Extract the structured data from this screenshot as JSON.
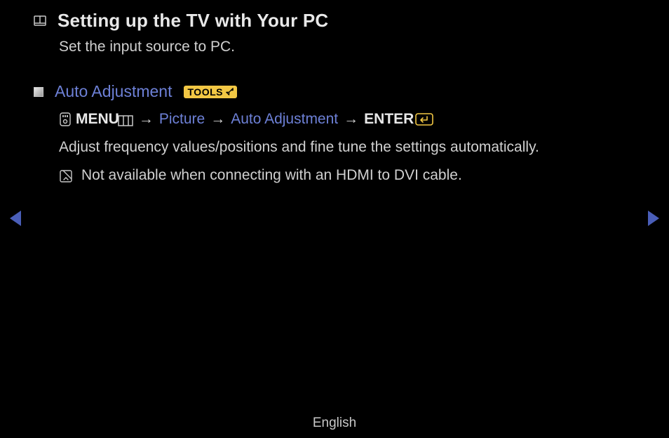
{
  "page": {
    "title": "Setting up the TV with Your PC",
    "subtitle": "Set the input source to PC."
  },
  "section": {
    "heading": "Auto Adjustment",
    "tools_label": "TOOLS"
  },
  "path": {
    "menu": "MENU",
    "step1": "Picture",
    "step2": "Auto Adjustment",
    "enter": "ENTER",
    "arrow": "→"
  },
  "description": "Adjust frequency values/positions and fine tune the settings automatically.",
  "note": "Not available when connecting with an HDMI to DVI cable.",
  "footer": {
    "language": "English"
  }
}
